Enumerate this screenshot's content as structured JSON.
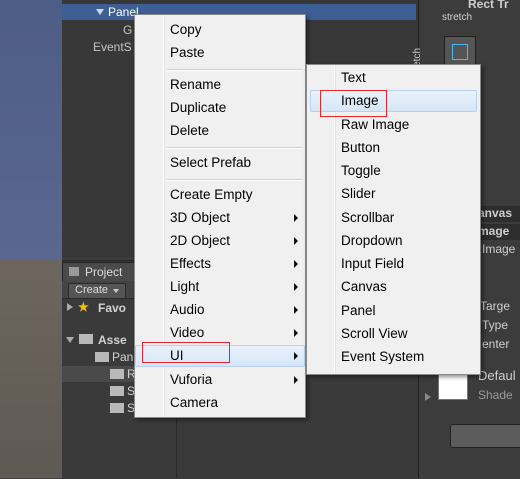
{
  "hierarchy": {
    "selected_item": "Panel",
    "items": [
      "G",
      "EventS"
    ]
  },
  "project": {
    "tab_label": "Project",
    "create_label": "Create",
    "favorites_label": "Favo",
    "assets_label": "Asse",
    "folders": [
      "Pan",
      "R",
      "S",
      "S"
    ]
  },
  "inspector": {
    "rect_label": "Rect Tr",
    "stretch_label": "stretch",
    "stretch_vertical": "stretch",
    "canvas_label": "anvas",
    "image_label": "mage",
    "image_sub": "Image",
    "target_label": "Targe",
    "type_label": "Type",
    "center_label": "enter",
    "default_label": "Defaul",
    "shader_label": "Shade"
  },
  "context_menu": {
    "items": [
      {
        "label": "Copy",
        "submenu": false
      },
      {
        "label": "Paste",
        "submenu": false
      },
      {
        "label": "Rename",
        "submenu": false
      },
      {
        "label": "Duplicate",
        "submenu": false
      },
      {
        "label": "Delete",
        "submenu": false
      },
      {
        "label": "Select Prefab",
        "submenu": false
      },
      {
        "label": "Create Empty",
        "submenu": false
      },
      {
        "label": "3D Object",
        "submenu": true
      },
      {
        "label": "2D Object",
        "submenu": true
      },
      {
        "label": "Effects",
        "submenu": true
      },
      {
        "label": "Light",
        "submenu": true
      },
      {
        "label": "Audio",
        "submenu": true
      },
      {
        "label": "Video",
        "submenu": true
      },
      {
        "label": "UI",
        "submenu": true,
        "active": true
      },
      {
        "label": "Vuforia",
        "submenu": true
      },
      {
        "label": "Camera",
        "submenu": false
      }
    ]
  },
  "ui_submenu": {
    "items": [
      {
        "label": "Text"
      },
      {
        "label": "Image",
        "highlighted": true
      },
      {
        "label": "Raw Image"
      },
      {
        "label": "Button"
      },
      {
        "label": "Toggle"
      },
      {
        "label": "Slider"
      },
      {
        "label": "Scrollbar"
      },
      {
        "label": "Dropdown"
      },
      {
        "label": "Input Field"
      },
      {
        "label": "Canvas"
      },
      {
        "label": "Panel"
      },
      {
        "label": "Scroll View"
      },
      {
        "label": "Event System"
      }
    ]
  },
  "colors": {
    "annotation_red": "#e8242c",
    "selection_blue": "#3e5f96",
    "menu_bg": "#f0f0f0"
  }
}
